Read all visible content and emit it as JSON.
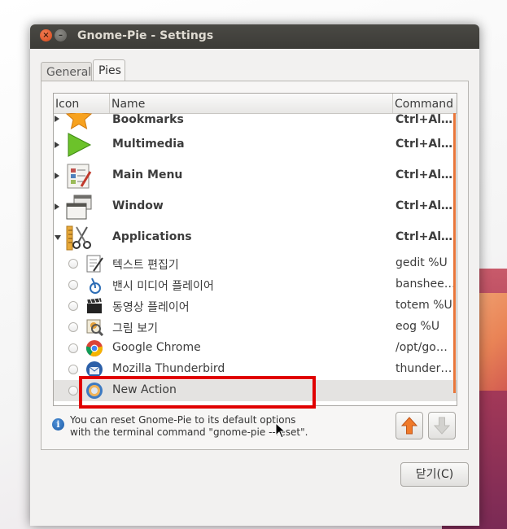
{
  "window": {
    "title": "Gnome-Pie - Settings"
  },
  "tabs": [
    {
      "label": "General"
    },
    {
      "label": "Pies"
    }
  ],
  "table": {
    "columns": {
      "icon": "Icon",
      "name": "Name",
      "command": "Command"
    },
    "rows": [
      {
        "name": "Bookmarks",
        "command": "Ctrl+Al…",
        "icon": "bookmarks-star-icon"
      },
      {
        "name": "Multimedia",
        "command": "Ctrl+Al…",
        "icon": "multimedia-play-icon"
      },
      {
        "name": "Main Menu",
        "command": "Ctrl+Al…",
        "icon": "main-menu-icon"
      },
      {
        "name": "Window",
        "command": "Ctrl+Al…",
        "icon": "window-icon"
      },
      {
        "name": "Applications",
        "command": "Ctrl+Al…",
        "icon": "applications-icon"
      },
      {
        "name": "텍스트 편집기",
        "command": "gedit %U",
        "icon": "text-editor-icon"
      },
      {
        "name": "밴시 미디어 플레이어",
        "command": "banshee…",
        "icon": "banshee-icon"
      },
      {
        "name": "동영상 플레이어",
        "command": "totem %U",
        "icon": "video-player-icon"
      },
      {
        "name": "그림 보기",
        "command": "eog %U",
        "icon": "image-viewer-icon"
      },
      {
        "name": "Google Chrome",
        "command": "/opt/go…",
        "icon": "chrome-icon"
      },
      {
        "name": "Mozilla Thunderbird",
        "command": "thunder…",
        "icon": "thunderbird-icon"
      },
      {
        "name": "New Action",
        "command": "",
        "icon": "new-action-icon"
      }
    ]
  },
  "info": {
    "line1": "You can reset Gnome-Pie to its default options",
    "line2": "with the terminal command \"gnome-pie --reset\"."
  },
  "buttons": {
    "close": "닫기(C)"
  },
  "colors": {
    "accent": "#e8763a",
    "highlight": "#e00000"
  }
}
